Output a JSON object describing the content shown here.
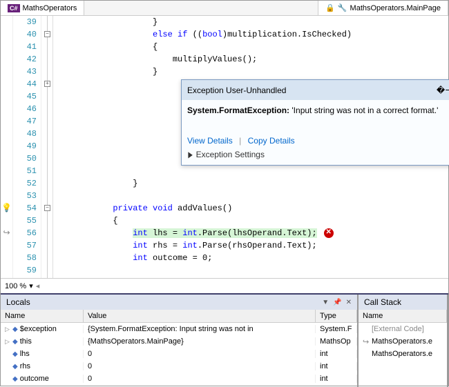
{
  "tabs": {
    "left": "MathsOperators",
    "right": "MathsOperators.MainPage"
  },
  "lines": [
    {
      "n": 39,
      "indent": "                    ",
      "code": [
        {
          "t": "}",
          "c": ""
        }
      ]
    },
    {
      "n": 40,
      "fold": "-",
      "indent": "                    ",
      "code": [
        {
          "t": "else if",
          "c": "kw"
        },
        {
          "t": " ((",
          "c": ""
        },
        {
          "t": "bool",
          "c": "type"
        },
        {
          "t": ")multiplication.IsChecked)",
          "c": ""
        }
      ]
    },
    {
      "n": 41,
      "indent": "                    ",
      "code": [
        {
          "t": "{",
          "c": ""
        }
      ]
    },
    {
      "n": 42,
      "indent": "                        ",
      "code": [
        {
          "t": "multiplyValues();",
          "c": ""
        }
      ]
    },
    {
      "n": 43,
      "indent": "                    ",
      "code": [
        {
          "t": "}",
          "c": ""
        }
      ]
    },
    {
      "n": 44,
      "fold": "+",
      "indent": "",
      "code": []
    },
    {
      "n": 45,
      "indent": "",
      "code": []
    },
    {
      "n": 46,
      "indent": "",
      "code": []
    },
    {
      "n": 47,
      "indent": "",
      "code": []
    },
    {
      "n": 48,
      "indent": "",
      "code": []
    },
    {
      "n": 49,
      "indent": "",
      "code": []
    },
    {
      "n": 50,
      "indent": "",
      "code": []
    },
    {
      "n": 51,
      "indent": "",
      "code": []
    },
    {
      "n": 52,
      "indent": "                ",
      "code": [
        {
          "t": "}",
          "c": ""
        }
      ]
    },
    {
      "n": 53,
      "indent": "",
      "code": []
    },
    {
      "n": 54,
      "fold": "-",
      "mark": "bulb",
      "indent": "            ",
      "code": [
        {
          "t": "private",
          "c": "kw"
        },
        {
          "t": " ",
          "c": ""
        },
        {
          "t": "void",
          "c": "kw"
        },
        {
          "t": " addValues()",
          "c": ""
        }
      ]
    },
    {
      "n": 55,
      "indent": "            ",
      "code": [
        {
          "t": "{",
          "c": ""
        }
      ]
    },
    {
      "n": 56,
      "mark": "ret",
      "hl": true,
      "err": true,
      "indent": "                ",
      "code": [
        {
          "t": "int",
          "c": "type"
        },
        {
          "t": " lhs = ",
          "c": ""
        },
        {
          "t": "int",
          "c": "type"
        },
        {
          "t": ".Parse(lhsOperand.Text);",
          "c": ""
        }
      ]
    },
    {
      "n": 57,
      "indent": "                ",
      "code": [
        {
          "t": "int",
          "c": "type"
        },
        {
          "t": " rhs = ",
          "c": ""
        },
        {
          "t": "int",
          "c": "type"
        },
        {
          "t": ".Parse(rhsOperand.Text);",
          "c": ""
        }
      ]
    },
    {
      "n": 58,
      "indent": "                ",
      "code": [
        {
          "t": "int",
          "c": "type"
        },
        {
          "t": " outcome = 0;",
          "c": ""
        }
      ]
    },
    {
      "n": 59,
      "indent": "",
      "code": []
    }
  ],
  "exception": {
    "title": "Exception User-Unhandled",
    "type": "System.FormatException:",
    "message": "'Input string was not in a correct format.'",
    "view": "View Details",
    "copy": "Copy Details",
    "settings": "Exception Settings"
  },
  "zoom": "100 %",
  "locals": {
    "title": "Locals",
    "cols": [
      "Name",
      "Value",
      "Type"
    ],
    "rows": [
      {
        "exp": true,
        "name": "$exception",
        "value": "{System.FormatException: Input string was not in",
        "type": "System.F"
      },
      {
        "exp": true,
        "name": "this",
        "value": "{MathsOperators.MainPage}",
        "type": "MathsOp"
      },
      {
        "exp": false,
        "name": "lhs",
        "value": "0",
        "type": "int"
      },
      {
        "exp": false,
        "name": "rhs",
        "value": "0",
        "type": "int"
      },
      {
        "exp": false,
        "name": "outcome",
        "value": "0",
        "type": "int"
      }
    ]
  },
  "callstack": {
    "title": "Call Stack",
    "col": "Name",
    "rows": [
      {
        "ext": true,
        "text": "[External Code]"
      },
      {
        "ret": true,
        "text": "MathsOperators.e"
      },
      {
        "text": "MathsOperators.e"
      }
    ]
  }
}
